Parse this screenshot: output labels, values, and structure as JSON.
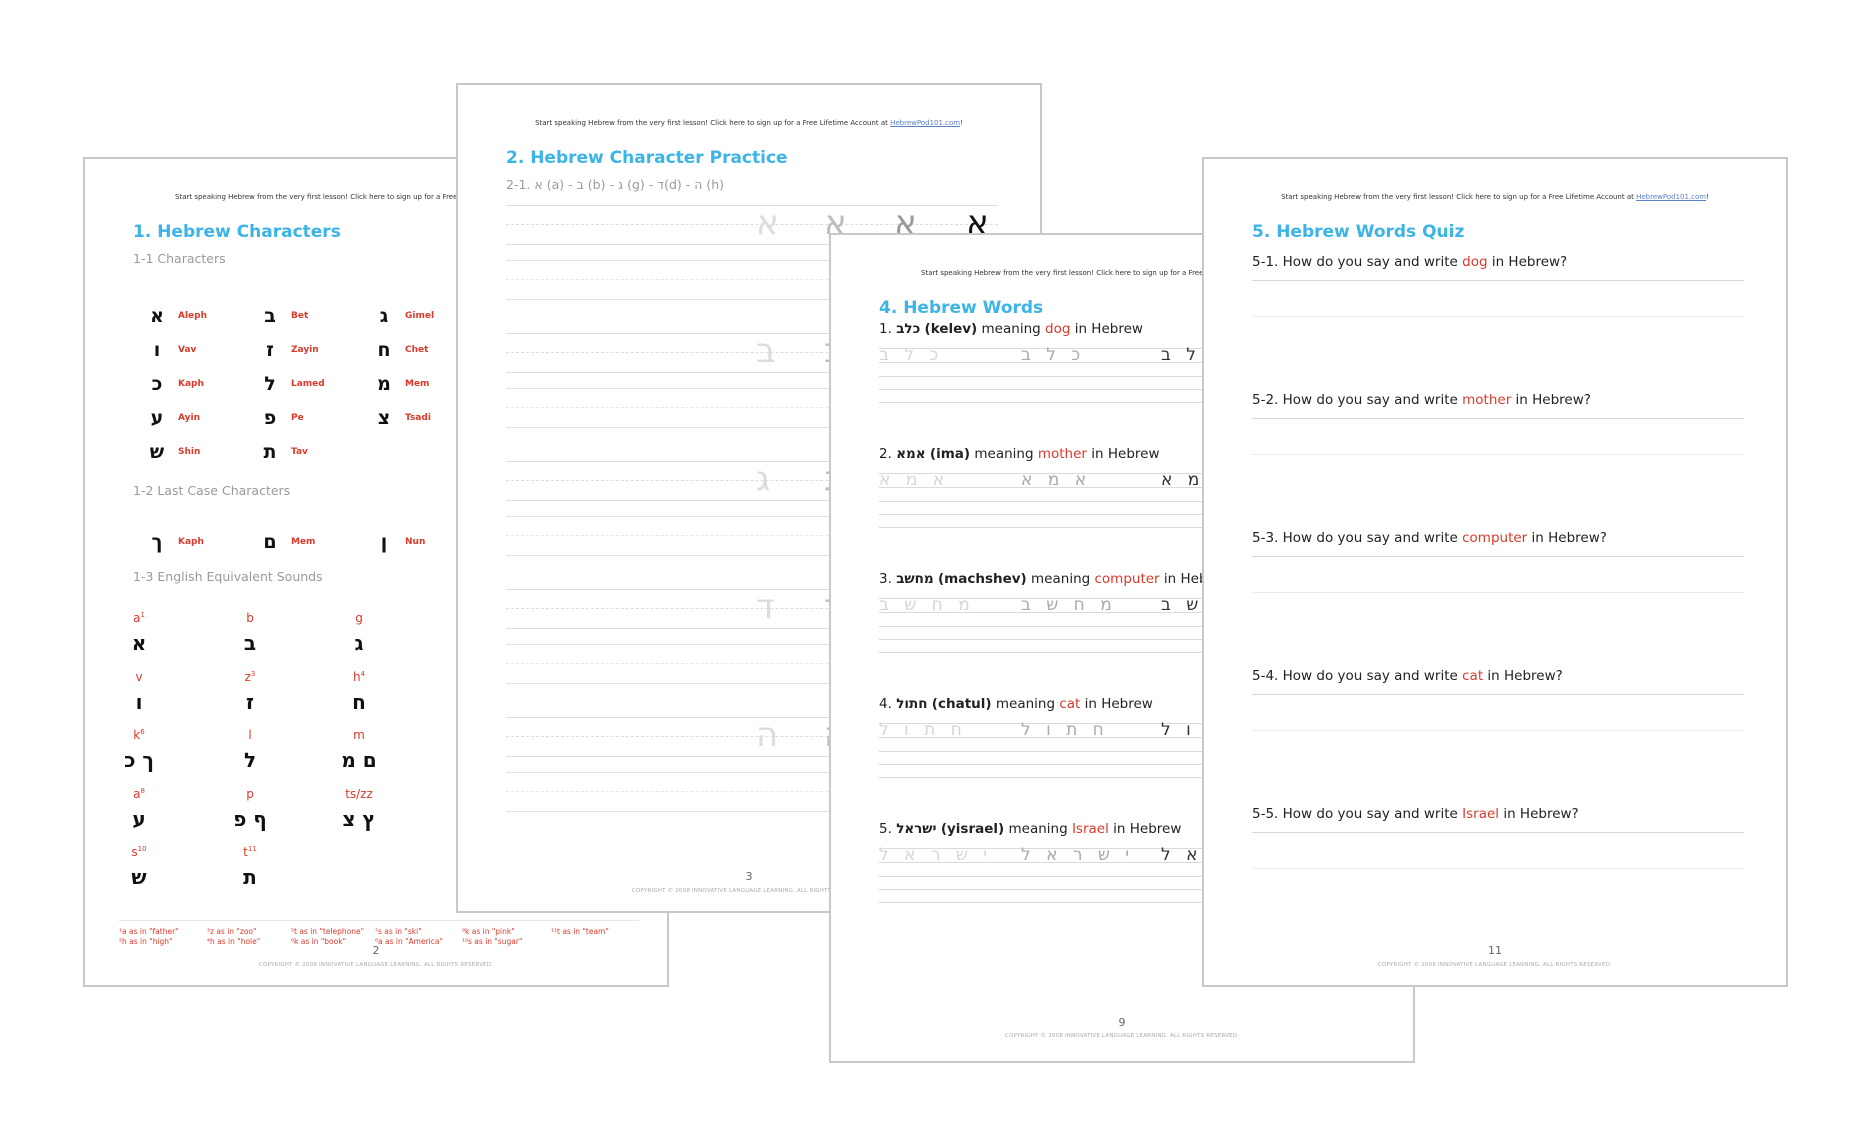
{
  "banner": {
    "text": "Start speaking Hebrew from the very first lesson! Click here to sign up for a Free Lifetime Account at ",
    "link": "HebrewPod101.com",
    "end": "!"
  },
  "copyright": "COPYRIGHT © 2008 INNOVATIVE LANGUAGE LEARNING. ALL RIGHTS RESERVED.",
  "colors": {
    "title": "#3cb4e6",
    "accent_red": "#d93a2b",
    "subtitle": "#9a9a9a"
  },
  "page1": {
    "title": "1. Hebrew Characters",
    "sub1": "1-1 Characters",
    "characters": [
      {
        "glyph": "א",
        "name": "Aleph"
      },
      {
        "glyph": "ב",
        "name": "Bet"
      },
      {
        "glyph": "ג",
        "name": "Gimel"
      },
      {
        "glyph": "ו",
        "name": "Vav"
      },
      {
        "glyph": "ז",
        "name": "Zayin"
      },
      {
        "glyph": "ח",
        "name": "Chet"
      },
      {
        "glyph": "כ",
        "name": "Kaph"
      },
      {
        "glyph": "ל",
        "name": "Lamed"
      },
      {
        "glyph": "מ",
        "name": "Mem"
      },
      {
        "glyph": "ע",
        "name": "Ayin"
      },
      {
        "glyph": "פ",
        "name": "Pe"
      },
      {
        "glyph": "צ",
        "name": "Tsadi"
      },
      {
        "glyph": "ש",
        "name": "Shin"
      },
      {
        "glyph": "ת",
        "name": "Tav"
      }
    ],
    "sub2": "1-2 Last Case Characters",
    "final_characters": [
      {
        "glyph": "ך",
        "name": "Kaph"
      },
      {
        "glyph": "ם",
        "name": "Mem"
      },
      {
        "glyph": "ן",
        "name": "Nun"
      }
    ],
    "sub3": "1-3 English Equivalent Sounds",
    "sounds": [
      {
        "latin": "a",
        "sup": "1",
        "hebrew": "א"
      },
      {
        "latin": "b",
        "sup": "",
        "hebrew": "ב"
      },
      {
        "latin": "g",
        "sup": "",
        "hebrew": "ג"
      },
      {
        "latin": "v",
        "sup": "",
        "hebrew": "ו"
      },
      {
        "latin": "z",
        "sup": "3",
        "hebrew": "ז"
      },
      {
        "latin": "h",
        "sup": "4",
        "hebrew": "ח"
      },
      {
        "latin": "k",
        "sup": "6",
        "hebrew": "ך כ"
      },
      {
        "latin": "l",
        "sup": "",
        "hebrew": "ל"
      },
      {
        "latin": "m",
        "sup": "",
        "hebrew": "ם מ"
      },
      {
        "latin": "a",
        "sup": "8",
        "hebrew": "ע"
      },
      {
        "latin": "p",
        "sup": "",
        "hebrew": "ף פ"
      },
      {
        "latin": "ts/zz",
        "sup": "",
        "hebrew": "ץ צ"
      },
      {
        "latin": "s",
        "sup": "10",
        "hebrew": "ש"
      },
      {
        "latin": "t",
        "sup": "11",
        "hebrew": "ת"
      }
    ],
    "footnotes": [
      "¹a as in \"father\"",
      "²h as in \"high\"",
      "³z as in \"zoo\"",
      "⁴h as in \"hole\"",
      "⁵t as in \"telephone\"",
      "⁶k as in \"book\"",
      "⁷s as in \"ski\"",
      "⁸a as in \"America\"",
      "⁹k as in \"pink\"",
      "¹⁰s as in \"sugar\"",
      "¹¹t as in \"team\""
    ],
    "page_number": "2"
  },
  "page2": {
    "title": "2. Hebrew Character Practice",
    "sub": "2-1. א (a) - ב (b) - ג (g) - ד(d) - ה (h)",
    "practice_letters": [
      "א",
      "ב",
      "ג",
      "ד",
      "ה"
    ],
    "page_number": "3"
  },
  "page3": {
    "title": "4. Hebrew Words",
    "words": [
      {
        "num": "1.",
        "hebrew": "כלב",
        "translit": "(kelev)",
        "meaning_pre": "meaning",
        "meaning": "dog",
        "post": "in Hebrew",
        "spaced": "כ ל ב"
      },
      {
        "num": "2.",
        "hebrew": "אמא",
        "translit": "(ima)",
        "meaning_pre": "meaning",
        "meaning": "mother",
        "post": "in Hebrew",
        "spaced": "א מ א"
      },
      {
        "num": "3.",
        "hebrew": "מחשב",
        "translit": "(machshev)",
        "meaning_pre": "meaning",
        "meaning": "computer",
        "post": "in Hebrew",
        "spaced": "מ ח ש ב"
      },
      {
        "num": "4.",
        "hebrew": "חתול",
        "translit": "(chatul)",
        "meaning_pre": "meaning",
        "meaning": "cat",
        "post": "in Hebrew",
        "spaced": "ח ת ו ל"
      },
      {
        "num": "5.",
        "hebrew": "ישראל",
        "translit": "(yisrael)",
        "meaning_pre": "meaning",
        "meaning": "Israel",
        "post": "in Hebrew",
        "spaced": "י ש ר א ל"
      }
    ],
    "page_number": "9"
  },
  "page4": {
    "title": "5. Hebrew Words Quiz",
    "questions": [
      {
        "num": "5-1.",
        "pre": "How do you say and write",
        "word": "dog",
        "post": "in Hebrew?"
      },
      {
        "num": "5-2.",
        "pre": "How do you say and write",
        "word": "mother",
        "post": "in Hebrew?"
      },
      {
        "num": "5-3.",
        "pre": "How do you say and write",
        "word": "computer",
        "post": "in Hebrew?"
      },
      {
        "num": "5-4.",
        "pre": "How do you say and write",
        "word": "cat",
        "post": "in Hebrew?"
      },
      {
        "num": "5-5.",
        "pre": "How do you say and write",
        "word": "Israel",
        "post": "in Hebrew?"
      }
    ],
    "page_number": "11"
  }
}
